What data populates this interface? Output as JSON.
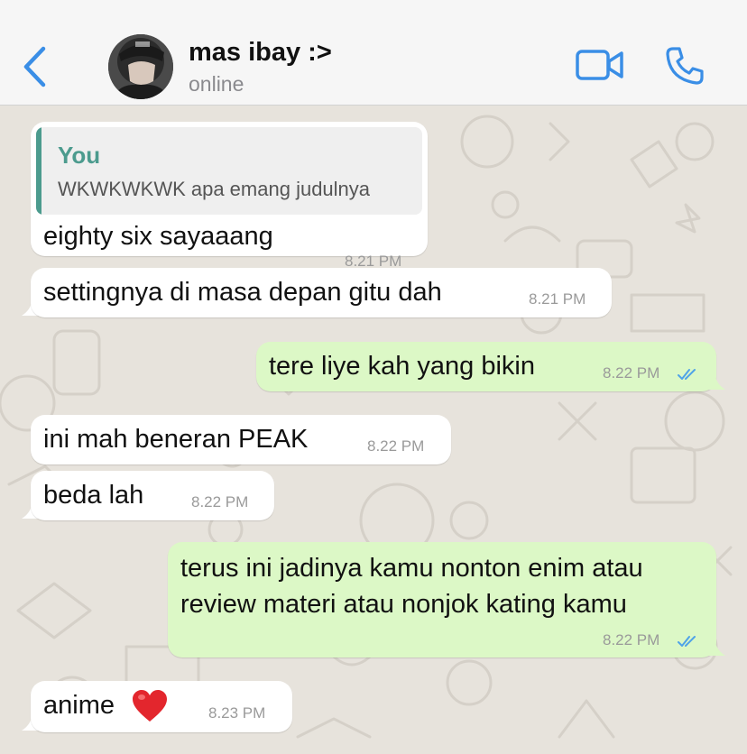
{
  "header": {
    "contact_name": "mas ibay :>",
    "status": "online"
  },
  "icons": {
    "back": "chevron-left-icon",
    "video": "video-camera-icon",
    "call": "phone-icon",
    "read_receipt": "double-check-icon",
    "heart": "red-heart-emoji"
  },
  "colors": {
    "accent": "#3a8ee6",
    "incoming_bubble": "#ffffff",
    "outgoing_bubble": "#dcf8c6",
    "quote_accent": "#4c9b8e",
    "read_ticks": "#4fa3e8",
    "chat_background": "#e7e3dc"
  },
  "messages": [
    {
      "direction": "incoming",
      "quote": {
        "author": "You",
        "text": "WKWKWKWK apa emang judulnya"
      },
      "text": "eighty six sayaaang",
      "time": "8.21 PM"
    },
    {
      "direction": "incoming",
      "text": "settingnya di masa depan gitu dah",
      "time": "8.21 PM"
    },
    {
      "direction": "outgoing",
      "text": "tere liye kah yang bikin",
      "time": "8.22 PM",
      "read": true
    },
    {
      "direction": "incoming",
      "text": "ini mah beneran PEAK",
      "time": "8.22 PM"
    },
    {
      "direction": "incoming",
      "text": "beda lah",
      "time": "8.22 PM"
    },
    {
      "direction": "outgoing",
      "lines": [
        "terus ini jadinya kamu nonton enim atau",
        "review materi atau nonjok kating kamu"
      ],
      "time": "8.22 PM",
      "read": true
    },
    {
      "direction": "incoming",
      "text": "anime",
      "emoji": "❤️",
      "time": "8.23 PM"
    }
  ]
}
